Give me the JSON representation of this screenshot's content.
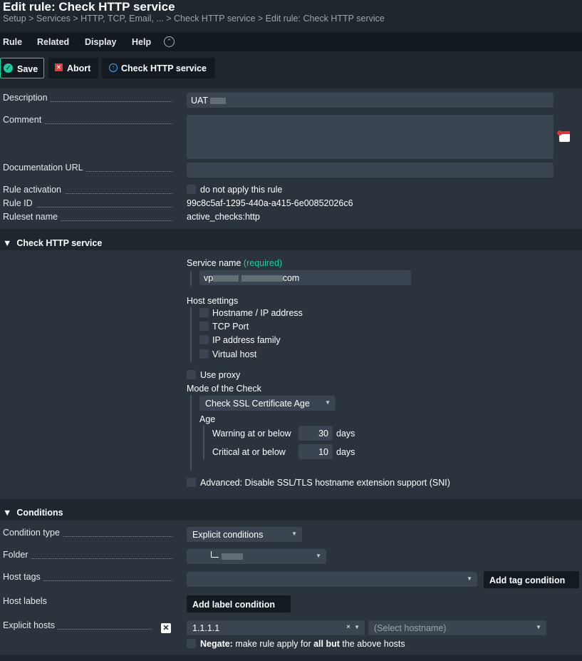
{
  "header": {
    "title": "Edit rule: Check HTTP service",
    "breadcrumb": "Setup > Services > HTTP, TCP, Email, ... > Check HTTP service > Edit rule: Check HTTP service"
  },
  "menu": {
    "items": [
      "Rule",
      "Related",
      "Display",
      "Help"
    ]
  },
  "toolbar": {
    "save": "Save",
    "abort": "Abort",
    "check": "Check HTTP service"
  },
  "properties": {
    "description_label": "Description",
    "description_value": "UAT",
    "comment_label": "Comment",
    "comment_value": "",
    "doc_url_label": "Documentation URL",
    "doc_url_value": "",
    "activation_label": "Rule activation",
    "activation_checkbox": "do not apply this rule",
    "rule_id_label": "Rule ID",
    "rule_id_value": "99c8c5af-1295-440a-a415-6e00852026c6",
    "ruleset_label": "Ruleset name",
    "ruleset_value": "active_checks:http"
  },
  "check_section": {
    "header": "Check HTTP service",
    "service_name_label": "Service name",
    "required_tag": "(required)",
    "service_name_prefix": "vp",
    "service_name_suffix": "com",
    "host_settings_label": "Host settings",
    "host_settings": [
      "Hostname / IP address",
      "TCP Port",
      "IP address family",
      "Virtual host"
    ],
    "use_proxy": "Use proxy",
    "mode_label": "Mode of the Check",
    "mode_value": "Check SSL Certificate Age",
    "age_label": "Age",
    "warning_label": "Warning at or below",
    "warning_value": "30",
    "critical_label": "Critical at or below",
    "critical_value": "10",
    "days_unit": "days",
    "advanced_sni": "Advanced: Disable SSL/TLS hostname extension support (SNI)"
  },
  "conditions": {
    "header": "Conditions",
    "condition_type_label": "Condition type",
    "condition_type_value": "Explicit conditions",
    "folder_label": "Folder",
    "host_tags_label": "Host tags",
    "add_tag_condition": "Add tag condition",
    "host_labels_label": "Host labels",
    "add_label_condition": "Add label condition",
    "explicit_hosts_label": "Explicit hosts",
    "explicit_host_value": "1.1.1.1",
    "select_hostname_placeholder": "(Select hostname)",
    "negate_bold": "Negate:",
    "negate_text_1": " make rule apply for ",
    "negate_bold_2": "all but",
    "negate_text_2": " the above hosts"
  },
  "icons": {
    "save": "checkmark-circle-icon",
    "abort": "close-square-icon",
    "check": "arrow-up-circle-icon",
    "collapse": "chevron-up-circle-icon",
    "comment_stamp": "calendar-stamp-icon",
    "remove_host": "close-icon"
  },
  "colors": {
    "accent": "#15d1a0",
    "required": "#15d1a0",
    "error": "#e53a3a",
    "link": "#3ea8ff",
    "background": "#1e262e",
    "panel": "#2b333c",
    "input": "#3b4551"
  }
}
